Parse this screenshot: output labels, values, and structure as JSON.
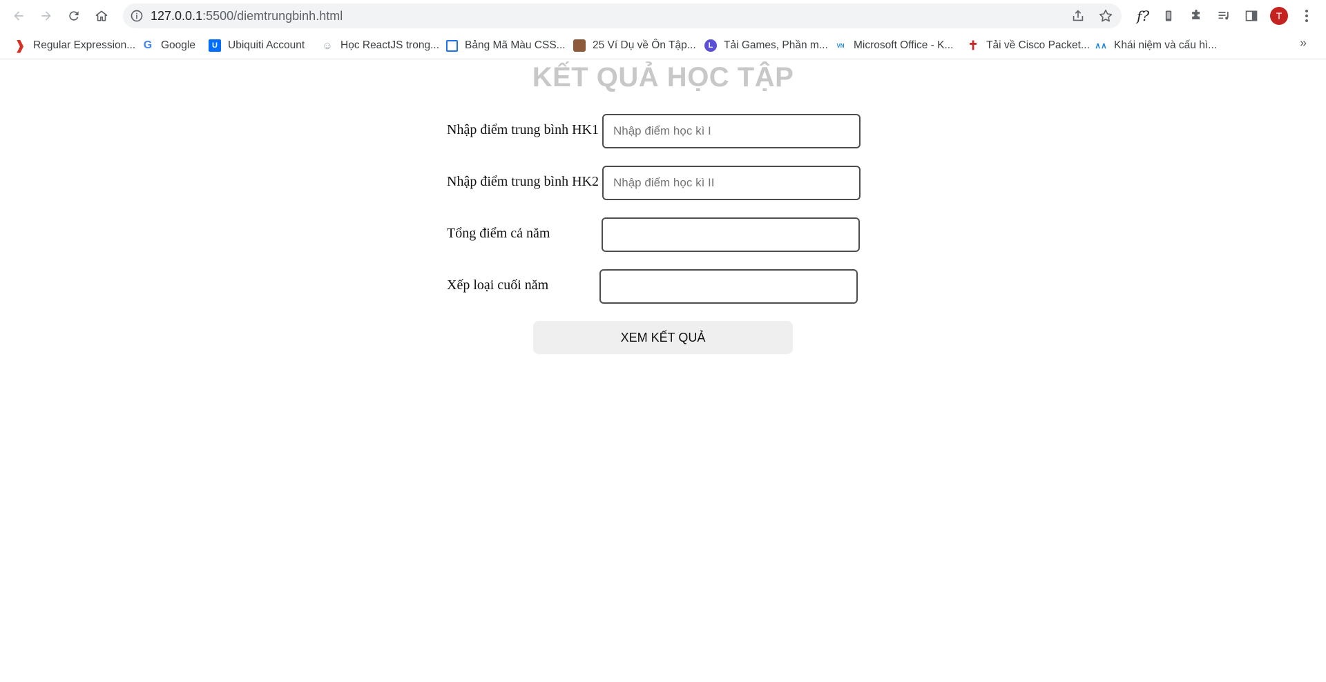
{
  "browser": {
    "url_host": "127.0.0.1",
    "url_path": ":5500/diemtrungbinh.html",
    "avatar_initial": "T",
    "ext_label": "f?"
  },
  "bookmarks": [
    {
      "label": "Regular Expression...",
      "icon": "regex-icon",
      "color": "#d93025"
    },
    {
      "label": "Google",
      "icon": "google-icon",
      "color": "#4285f4"
    },
    {
      "label": "Ubiquiti Account",
      "icon": "ubiquiti-icon",
      "color": "#006fff"
    },
    {
      "label": "Học ReactJS trong...",
      "icon": "face-sketch-icon",
      "color": "#9aa0a6"
    },
    {
      "label": "Bảng Mã Màu CSS...",
      "icon": "table-icon",
      "color": "#1a73e8"
    },
    {
      "label": "25 Ví Dụ về Ôn Tập...",
      "icon": "portrait-icon",
      "color": "#8d5a3b"
    },
    {
      "label": "Tải Games, Phần m...",
      "icon": "l-circle-icon",
      "color": "#5b4fd6"
    },
    {
      "label": "Microsoft Office - K...",
      "icon": "vn-zoom-icon",
      "color": "#1e88e5"
    },
    {
      "label": "Tải về Cisco Packet...",
      "icon": "cross-icon",
      "color": "#c62828"
    },
    {
      "label": "Khái niệm và cấu hì...",
      "icon": "vnpro-icon",
      "color": "#1e88e5"
    }
  ],
  "page": {
    "title": "KẾT QUẢ HỌC TẬP",
    "fields": [
      {
        "label": "Nhập điểm trung bình HK1",
        "placeholder": "Nhập điểm học kì I",
        "value": ""
      },
      {
        "label": "Nhập điểm trung bình HK2",
        "placeholder": "Nhập điểm học kì II",
        "value": ""
      },
      {
        "label": "Tổng điểm cả năm",
        "placeholder": "",
        "value": ""
      },
      {
        "label": "Xếp loại cuối năm",
        "placeholder": "",
        "value": ""
      }
    ],
    "submit_label": "XEM KẾT QUẢ"
  },
  "colors": {
    "title": "#c8c8c8",
    "button_bg": "#efefef",
    "input_border": "#4d4d4d",
    "avatar": "#c5221f"
  }
}
